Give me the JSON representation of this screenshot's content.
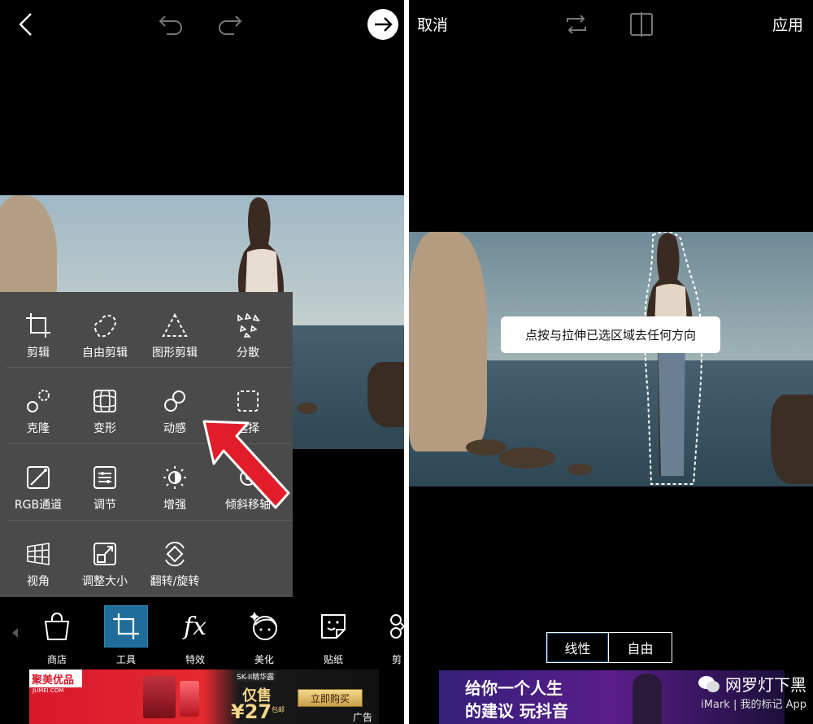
{
  "left": {
    "menu": {
      "rows": [
        [
          {
            "label": "剪辑",
            "icon": "crop-icon"
          },
          {
            "label": "自由剪辑",
            "icon": "free-crop-icon"
          },
          {
            "label": "图形剪辑",
            "icon": "shape-crop-icon"
          },
          {
            "label": "分散",
            "icon": "dispersion-icon"
          }
        ],
        [
          {
            "label": "克隆",
            "icon": "clone-icon"
          },
          {
            "label": "变形",
            "icon": "warp-icon"
          },
          {
            "label": "动感",
            "icon": "motion-icon"
          },
          {
            "label": "选择",
            "icon": "select-icon"
          }
        ],
        [
          {
            "label": "RGB通道",
            "icon": "rgb-curves-icon"
          },
          {
            "label": "调节",
            "icon": "adjust-icon"
          },
          {
            "label": "增强",
            "icon": "enhance-icon"
          },
          {
            "label": "倾斜移轴",
            "icon": "tilt-shift-icon"
          }
        ],
        [
          {
            "label": "视角",
            "icon": "perspective-icon"
          },
          {
            "label": "调整大小",
            "icon": "resize-icon"
          },
          {
            "label": "翻转/旋转",
            "icon": "flip-rotate-icon"
          }
        ]
      ]
    },
    "toolbar": {
      "items": [
        {
          "label": "商店",
          "icon": "shop-bag-icon"
        },
        {
          "label": "工具",
          "icon": "crop-tool-icon",
          "active": true
        },
        {
          "label": "特效",
          "icon": "fx-icon"
        },
        {
          "label": "美化",
          "icon": "beautify-face-icon"
        },
        {
          "label": "贴纸",
          "icon": "sticker-icon"
        },
        {
          "label": "剪",
          "icon": "cutout-icon"
        }
      ]
    },
    "ad": {
      "brand": "聚美优品",
      "brand_sub": "JUMEI.COM",
      "product": "SK-II精华露",
      "promo": "仅售",
      "price": "¥27",
      "price_unit": "包邮",
      "cta": "立即购买",
      "tag": "广告"
    }
  },
  "right": {
    "cancel": "取消",
    "apply": "应用",
    "tooltip": "点按与拉伸已选区域去任何方向",
    "tabs": {
      "linear": "线性",
      "free": "自由"
    },
    "ad": {
      "line1": "给你一个人生",
      "line2": "的建议 玩抖音"
    },
    "watermark": {
      "title": "网罗灯下黑",
      "sub": "iMark | 我的标记 App"
    }
  },
  "colors": {
    "menu_bg": "#4a4a4a",
    "active_tool": "#1f6e99",
    "arrow": "#e21d2a"
  }
}
